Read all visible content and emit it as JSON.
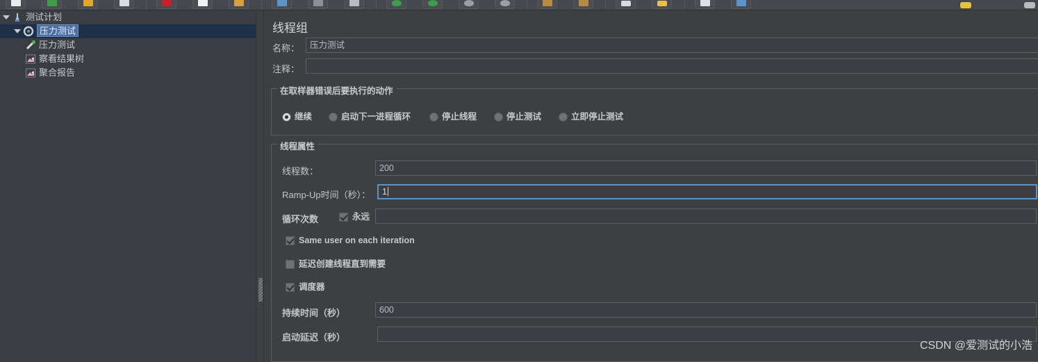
{
  "toolbar": {
    "buttons": [
      {
        "name": "new-file-icon",
        "color": "#e8eaec"
      },
      {
        "name": "open-template-icon",
        "color": "#3f9c4a"
      },
      {
        "name": "open-folder-icon",
        "color": "#e0a72c"
      },
      {
        "name": "save-icon",
        "color": "#d8dce0"
      },
      {
        "name": "cut-scissors-icon",
        "color": "#c4222a"
      },
      {
        "name": "copy-icon",
        "color": "#f0f2f4"
      },
      {
        "name": "paste-icon",
        "color": "#d8a13a"
      },
      {
        "name": "expand-icon",
        "color": "#5b92c9"
      },
      {
        "name": "collapse-icon",
        "color": "#8c9095"
      },
      {
        "name": "toggle-icon",
        "color": "#b8bcc0"
      },
      {
        "name": "start-icon",
        "color": "#3f9c4a"
      },
      {
        "name": "start-no-pause-icon",
        "color": "#3f9c4a"
      },
      {
        "name": "stop-icon",
        "color": "#9ca0a4"
      },
      {
        "name": "shutdown-icon",
        "color": "#9ca0a4"
      },
      {
        "name": "clear-icon",
        "color": "#b88b45"
      },
      {
        "name": "clear-all-icon",
        "color": "#b88b45"
      },
      {
        "name": "search-icon",
        "color": "#d8dce0"
      },
      {
        "name": "reset-search-icon",
        "color": "#e8c33a"
      },
      {
        "name": "function-helper-icon",
        "color": "#dde1e5"
      },
      {
        "name": "help-icon",
        "color": "#5b92c9"
      }
    ],
    "right_icons": [
      {
        "name": "warning-icon",
        "color": "#e8c33a"
      },
      {
        "name": "gear-icon",
        "color": "#b8bcc0"
      }
    ]
  },
  "tree": {
    "nodes": [
      {
        "label": "测试计划",
        "icon": "test-plan-icon",
        "indent": 4,
        "twisty": true,
        "selected": false
      },
      {
        "label": "压力测试",
        "icon": "thread-group-icon",
        "indent": 20,
        "twisty": true,
        "selected": true
      },
      {
        "label": "压力测试",
        "icon": "http-sampler-icon",
        "indent": 36,
        "twisty": false,
        "selected": false
      },
      {
        "label": "察看结果树",
        "icon": "view-results-tree-icon",
        "indent": 36,
        "twisty": false,
        "selected": false
      },
      {
        "label": "聚合报告",
        "icon": "aggregate-report-icon",
        "indent": 36,
        "twisty": false,
        "selected": false
      }
    ]
  },
  "main": {
    "title": "线程组",
    "name_label": "名称：",
    "name_value": "压力测试",
    "comment_label": "注释：",
    "comment_value": "",
    "error_action": {
      "group_title": "在取样器错误后要执行的动作",
      "options": [
        {
          "label": "继续",
          "selected": true
        },
        {
          "label": "启动下一进程循环",
          "selected": false
        },
        {
          "label": "停止线程",
          "selected": false
        },
        {
          "label": "停止测试",
          "selected": false
        },
        {
          "label": "立即停止测试",
          "selected": false
        }
      ]
    },
    "thread_props": {
      "group_title": "线程属性",
      "threads_label": "线程数：",
      "threads_value": "200",
      "rampup_label": "Ramp-Up时间（秒）：",
      "rampup_value": "1",
      "loops_label": "循环次数",
      "loops_forever_label": "永远",
      "loops_forever_checked": true,
      "loops_value": "",
      "same_user_label": "Same user on each iteration",
      "same_user_checked": true,
      "delayed_start_label": "延迟创建线程直到需要",
      "delayed_start_checked": false,
      "scheduler_label": "调度器",
      "scheduler_checked": true,
      "duration_label": "持续时间（秒）",
      "duration_value": "600",
      "startup_delay_label": "启动延迟（秒）",
      "startup_delay_value": ""
    }
  },
  "watermark": "CSDN @爱测试的小浩"
}
